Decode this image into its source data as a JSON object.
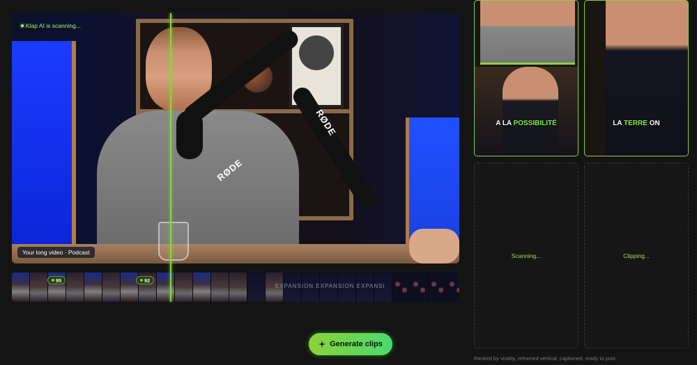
{
  "video": {
    "scan_status": "Klap AI is scanning...",
    "tag": "Your long video · Podcast",
    "brand_text_1": "RØDE",
    "brand_text_2": "RØDE"
  },
  "filmstrip": {
    "overlay_text": "EXPANSION EXPANSION EXPANSI",
    "scores": [
      "95",
      "92"
    ]
  },
  "clips": [
    {
      "caption_plain": "A LA ",
      "caption_highlight": "POSSIBILITÉ",
      "caption_tail": ""
    },
    {
      "caption_plain": "LA ",
      "caption_highlight": "TERRE",
      "caption_tail": " ON"
    },
    {
      "status": "Scanning..."
    },
    {
      "status": "Clipping..."
    }
  ],
  "footnote": "Ranked by virality, reframed vertical, captioned, ready to post.",
  "generate_button": {
    "label": "Generate clips",
    "icon": "sparkle-icon"
  },
  "colors": {
    "accent": "#8bd33a",
    "background": "#141414"
  }
}
